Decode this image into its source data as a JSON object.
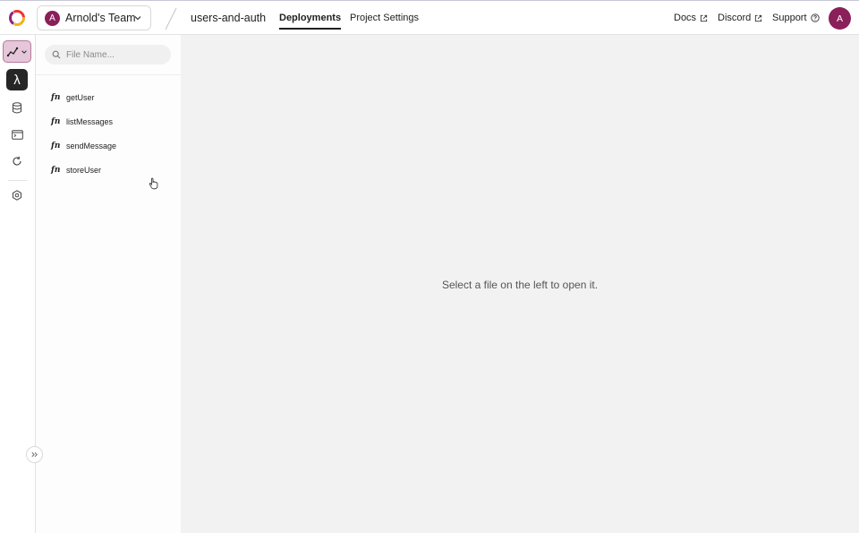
{
  "header": {
    "team": {
      "name": "Arnold's Team",
      "initial": "A"
    },
    "project": "users-and-auth",
    "tabs": [
      {
        "label": "Deployments",
        "active": true
      },
      {
        "label": "Project Settings",
        "active": false
      }
    ],
    "links": {
      "docs": "Docs",
      "discord": "Discord",
      "support": "Support"
    },
    "user_initial": "A"
  },
  "colors": {
    "accent": "#8a1f5a",
    "deployment_badge": "#e6c6d9"
  },
  "rail": {
    "items": [
      "deployment-selector",
      "functions-lambda-icon",
      "data-database-icon",
      "logs-terminal-icon",
      "history-refresh-icon",
      "settings-gear-icon"
    ],
    "lambda_glyph": "λ"
  },
  "panel": {
    "search_placeholder": "File Name...",
    "icon_label": "fn",
    "files": [
      "getUser",
      "listMessages",
      "sendMessage",
      "storeUser"
    ]
  },
  "main": {
    "empty_message": "Select a file on the left to open it."
  }
}
